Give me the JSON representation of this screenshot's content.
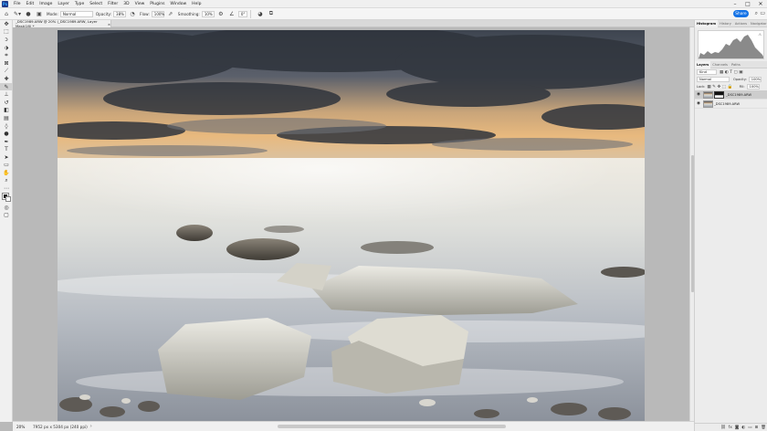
{
  "app": {
    "logo_text": "Ps",
    "menu": [
      "File",
      "Edit",
      "Image",
      "Layer",
      "Type",
      "Select",
      "Filter",
      "3D",
      "View",
      "Plugins",
      "Window",
      "Help"
    ],
    "window_controls": [
      "–",
      "□",
      "✕"
    ]
  },
  "options": {
    "mode_label": "Mode:",
    "mode_value": "Normal",
    "opacity_label": "Opacity:",
    "opacity_value": "38%",
    "flow_label": "Flow:",
    "flow_value": "100%",
    "smoothing_label": "Smoothing:",
    "smoothing_value": "10%",
    "angle_value": "0°",
    "share_label": "Share"
  },
  "document": {
    "tab_title": "_DSC1989.ARW @ 20% (_DSC1989.ARW, Layer Mask/16) *",
    "close_glyph": "×"
  },
  "status": {
    "zoom": "20%",
    "doc_info": "7952 px x 5304 px (240 ppi)",
    "arrow": "›"
  },
  "panels": {
    "top_tabs": [
      "Histogram",
      "History",
      "Actions",
      "Navigator"
    ],
    "layers_tabs": [
      "Layers",
      "Channels",
      "Paths"
    ],
    "kind_label": "Kind",
    "blend_mode": "Normal",
    "opacity_label": "Opacity:",
    "opacity_value": "100%",
    "lock_label": "Lock:",
    "fill_label": "Fill:",
    "fill_value": "100%",
    "layers": [
      {
        "name": "_DSC1989.ARW",
        "selected": true,
        "has_mask": true
      },
      {
        "name": "_DSC1989.ARW",
        "selected": false,
        "has_mask": false
      }
    ]
  }
}
